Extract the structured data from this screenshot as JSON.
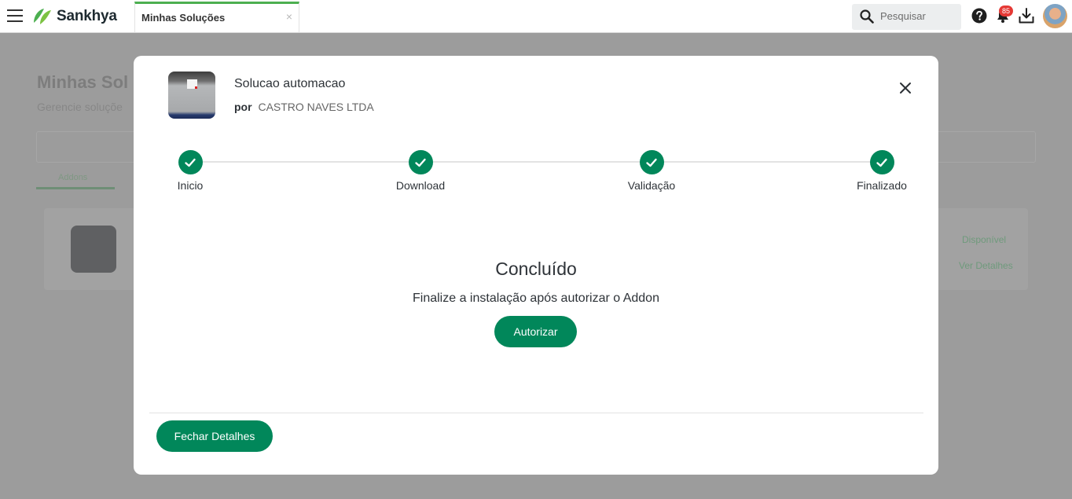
{
  "topbar": {
    "logo_text": "Sankhya",
    "tab_label": "Minhas Soluções",
    "tab_close": "×",
    "search_placeholder": "Pesquisar",
    "notification_count": "85"
  },
  "background": {
    "title": "Minhas Sol",
    "subtitle": "Gerencie soluçõe",
    "tab_label": "Addons",
    "card_status": "Disponível",
    "card_link": "Ver Detalhes"
  },
  "modal": {
    "solution_name": "Solucao automacao",
    "by_label": "por",
    "company": "CASTRO NAVES LTDA",
    "steps": [
      {
        "label": "Inicio",
        "done": true
      },
      {
        "label": "Download",
        "done": true
      },
      {
        "label": "Validação",
        "done": true
      },
      {
        "label": "Finalizado",
        "done": true
      }
    ],
    "status_title": "Concluído",
    "status_description": "Finalize a instalação após autorizar o Addon",
    "authorize_label": "Autorizar",
    "close_details_label": "Fechar Detalhes"
  },
  "colors": {
    "primary": "#01875a",
    "logo_green": "#4caf50",
    "badge_red": "#e53935"
  },
  "icons": [
    "menu-icon",
    "search-icon",
    "help-icon",
    "bell-icon",
    "download-icon",
    "close-icon",
    "check-icon"
  ]
}
